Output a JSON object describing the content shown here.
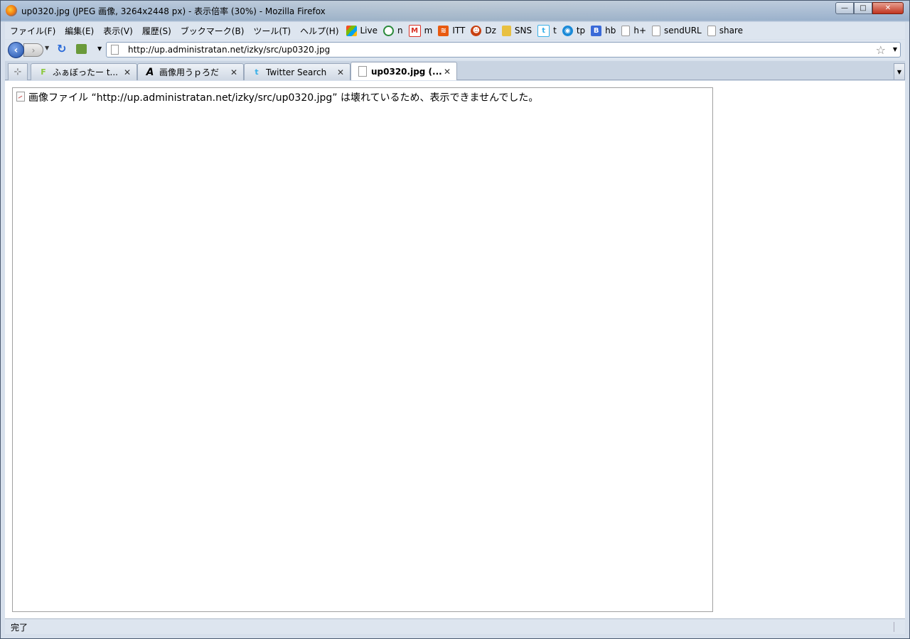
{
  "window": {
    "title": "up0320.jpg (JPEG 画像, 3264x2448 px) - 表示倍率 (30%) - Mozilla Firefox",
    "controls": {
      "minimize": "—",
      "maximize": "□",
      "close": "✕"
    }
  },
  "menu": [
    "ファイル(F)",
    "編集(E)",
    "表示(V)",
    "履歴(S)",
    "ブックマーク(B)",
    "ツール(T)",
    "ヘルプ(H)"
  ],
  "bookmarks": [
    {
      "label": "Live",
      "icon": "windows-live-icon",
      "color": "#3a8ad8"
    },
    {
      "label": "n",
      "icon": "n-icon",
      "color": "#2a8a3a"
    },
    {
      "label": "m",
      "icon": "gmail-icon",
      "color": "#d93025"
    },
    {
      "label": "ITT",
      "icon": "rss-icon",
      "color": "#e85a10"
    },
    {
      "label": "Dz",
      "icon": "dz-icon",
      "color": "#c84010"
    },
    {
      "label": "SNS",
      "icon": "folder-icon",
      "color": "#e8c040"
    },
    {
      "label": "t",
      "icon": "twitter-icon",
      "color": "#38b0e8"
    },
    {
      "label": "tp",
      "icon": "tp-icon",
      "color": "#1a8ad8"
    },
    {
      "label": "hb",
      "icon": "hatena-icon",
      "color": "#3a6ad8"
    },
    {
      "label": "h+",
      "icon": "page-icon",
      "color": "#ffffff"
    },
    {
      "label": "sendURL",
      "icon": "page-icon",
      "color": "#ffffff"
    },
    {
      "label": "share",
      "icon": "page-icon",
      "color": "#ffffff"
    }
  ],
  "nav": {
    "back": "‹",
    "forward": "›",
    "reload": "↻",
    "url": "http://up.administratan.net/izky/src/up0320.jpg"
  },
  "tabs": [
    {
      "label": "ふぁぼったー t...",
      "icon": "favotter-icon",
      "glyph": "F",
      "color": "#8ac83a",
      "active": false
    },
    {
      "label": "画像用うｐろだ",
      "icon": "a-icon",
      "glyph": "A",
      "color": "#000000",
      "active": false
    },
    {
      "label": "Twitter Search",
      "icon": "twitter-icon",
      "glyph": "t",
      "color": "#38b0e8",
      "active": false
    },
    {
      "label": "up0320.jpg (...",
      "icon": "page-icon",
      "glyph": "",
      "color": "#ffffff",
      "active": true
    }
  ],
  "content": {
    "error": "画像ファイル “http://up.administratan.net/izky/src/up0320.jpg” は壊れているため、表示できませんでした。"
  },
  "status": {
    "text": "完了"
  }
}
